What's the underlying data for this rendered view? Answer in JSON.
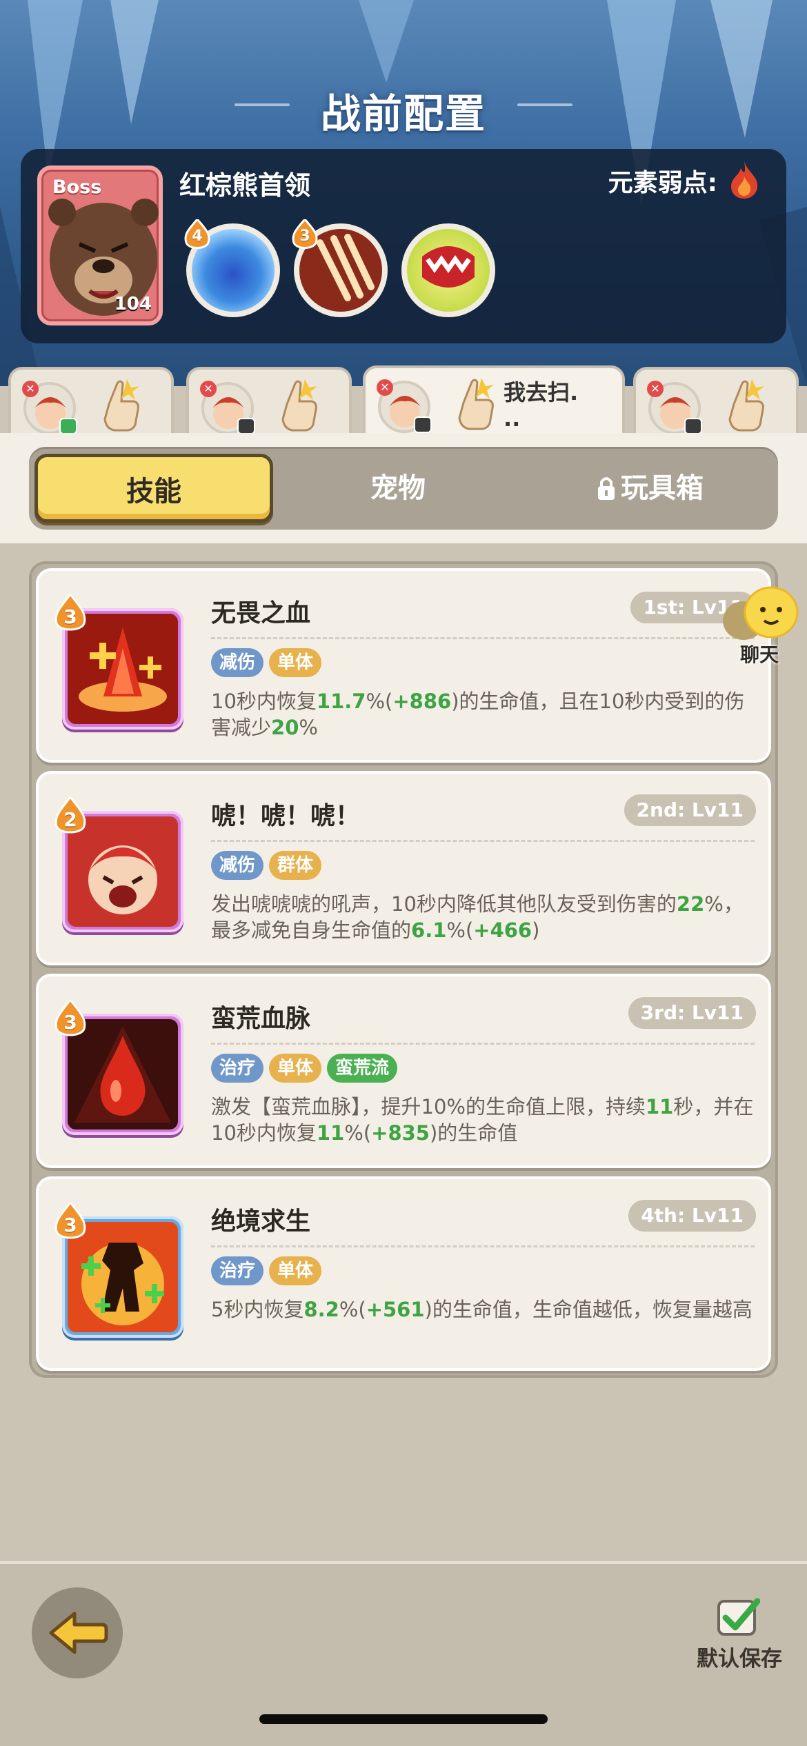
{
  "header": {
    "title": "战前配置"
  },
  "boss": {
    "tag": "Boss",
    "level": "104",
    "name": "红棕熊首领",
    "weakness_label": "元素弱点:",
    "weakness_icon": "fire-element-icon",
    "skills": [
      {
        "icon": "blue-spirit-skill-icon",
        "level": "4"
      },
      {
        "icon": "claw-slash-skill-icon",
        "level": "3"
      },
      {
        "icon": "bite-skill-icon",
        "level": ""
      }
    ]
  },
  "players": [
    {
      "controller": "green",
      "message": ""
    },
    {
      "controller": "dark",
      "message": ""
    },
    {
      "controller": "dark",
      "message": "我去扫.\n.."
    },
    {
      "controller": "dark",
      "message": ""
    }
  ],
  "tabs": {
    "skills": "技能",
    "pets": "宠物",
    "toybox": "玩具箱"
  },
  "skills": [
    {
      "name": "无畏之血",
      "slot_level": "1st: Lv11",
      "star": "3",
      "frame": "purple",
      "tags": [
        {
          "text": "减伤",
          "color": "blue"
        },
        {
          "text": "单体",
          "color": "orange"
        }
      ],
      "desc": [
        {
          "t": "10秒内恢复"
        },
        {
          "t": "11.7",
          "hl": true
        },
        {
          "t": "%("
        },
        {
          "t": "+886",
          "hl": true
        },
        {
          "t": ")的生命值，且在10秒内受到的伤害减少"
        },
        {
          "t": "20",
          "hl": true
        },
        {
          "t": "%"
        }
      ]
    },
    {
      "name": "唬！唬！唬！",
      "slot_level": "2nd: Lv11",
      "star": "2",
      "frame": "purple",
      "tags": [
        {
          "text": "减伤",
          "color": "blue"
        },
        {
          "text": "群体",
          "color": "orange"
        }
      ],
      "desc": [
        {
          "t": "发出唬唬唬的吼声，10秒内降低其他队友受到伤害的"
        },
        {
          "t": "22",
          "hl": true
        },
        {
          "t": "%，最多减免自身生命值的"
        },
        {
          "t": "6.1",
          "hl": true
        },
        {
          "t": "%("
        },
        {
          "t": "+466",
          "hl": true
        },
        {
          "t": ")"
        }
      ]
    },
    {
      "name": "蛮荒血脉",
      "slot_level": "3rd: Lv11",
      "star": "3",
      "frame": "purple",
      "tags": [
        {
          "text": "治疗",
          "color": "blue"
        },
        {
          "text": "单体",
          "color": "orange"
        },
        {
          "text": "蛮荒流",
          "color": "green"
        }
      ],
      "desc": [
        {
          "t": "激发【蛮荒血脉】，提升10%的生命值上限，持续"
        },
        {
          "t": "11",
          "hl": true
        },
        {
          "t": "秒，并在10秒内恢复"
        },
        {
          "t": "11",
          "hl": true
        },
        {
          "t": "%("
        },
        {
          "t": "+835",
          "hl": true
        },
        {
          "t": ")的生命值"
        }
      ]
    },
    {
      "name": "绝境求生",
      "slot_level": "4th: Lv11",
      "star": "3",
      "frame": "blue",
      "tags": [
        {
          "text": "治疗",
          "color": "blue"
        },
        {
          "text": "单体",
          "color": "orange"
        }
      ],
      "desc": [
        {
          "t": "5秒内恢复"
        },
        {
          "t": "8.2",
          "hl": true
        },
        {
          "t": "%("
        },
        {
          "t": "+561",
          "hl": true
        },
        {
          "t": ")的生命值，生命值越低，恢复量越高"
        }
      ]
    }
  ],
  "chat": {
    "label": "聊天"
  },
  "footer": {
    "save_label": "默认保存"
  },
  "colors": {
    "highlight_green": "#3ea342",
    "tab_active": "#f8de6e",
    "panel_bg": "#cbc4b5"
  }
}
